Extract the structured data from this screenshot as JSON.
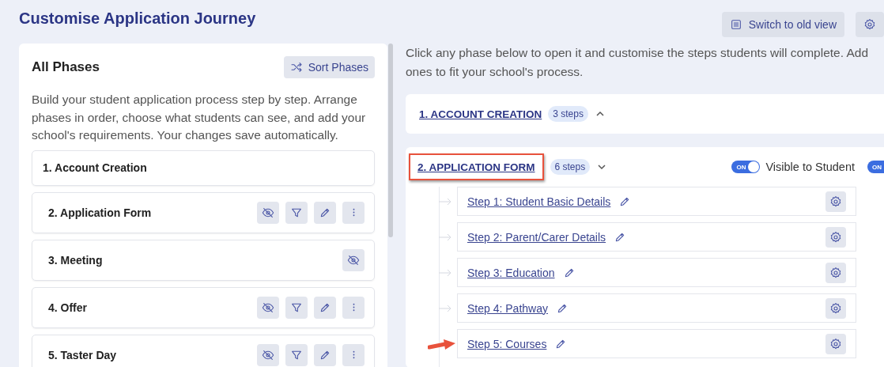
{
  "title": "Customise Application Journey",
  "top_buttons": [
    {
      "kind": "list",
      "label": "Switch to old view"
    },
    {
      "kind": "gear"
    }
  ],
  "left_panel": {
    "heading": "All Phases",
    "sort_button": "Sort Phases",
    "description": "Build your student application process step by step. Arrange phases in order, choose what students can see, and add your school's requirements. Your changes save automatically.",
    "phases": [
      {
        "title": "1. Account Creation"
      },
      {
        "title": "2. Application Form",
        "actions": [
          {
            "kind": "hide"
          },
          {
            "kind": "filter"
          },
          {
            "kind": "edit"
          },
          {
            "kind": "more"
          }
        ]
      },
      {
        "title": "3. Meeting",
        "actions": [
          {
            "kind": "hide"
          }
        ]
      },
      {
        "title": "4. Offer",
        "actions": [
          {
            "kind": "hide"
          },
          {
            "kind": "filter"
          },
          {
            "kind": "edit"
          },
          {
            "kind": "more"
          }
        ]
      },
      {
        "title": "5. Taster Day",
        "actions": [
          {
            "kind": "hide"
          },
          {
            "kind": "filter"
          },
          {
            "kind": "edit"
          },
          {
            "kind": "more"
          }
        ]
      }
    ]
  },
  "intro_lines": [
    "Click any phase below to open it and customise the steps students will complete. Add",
    "ones to fit your school's process."
  ],
  "phase_sections": [
    {
      "title": "1. ACCOUNT CREATION",
      "count": "3 steps",
      "expanded": false,
      "highlighted": false
    },
    {
      "title": "2. APPLICATION FORM",
      "count": "6 steps",
      "expanded": true,
      "highlighted": true,
      "toggles": [
        {
          "on": true,
          "switch_label": "ON",
          "label": "Visible to Student"
        },
        {
          "on": true,
          "switch_label": "ON"
        }
      ],
      "steps": [
        {
          "title": "Step 1: Student Basic Details",
          "pointed": false
        },
        {
          "title": "Step 2: Parent/Carer Details",
          "pointed": false
        },
        {
          "title": "Step 3: Education",
          "pointed": false
        },
        {
          "title": "Step 4: Pathway",
          "pointed": false
        },
        {
          "title": "Step 5: Courses",
          "pointed": true
        }
      ]
    }
  ]
}
